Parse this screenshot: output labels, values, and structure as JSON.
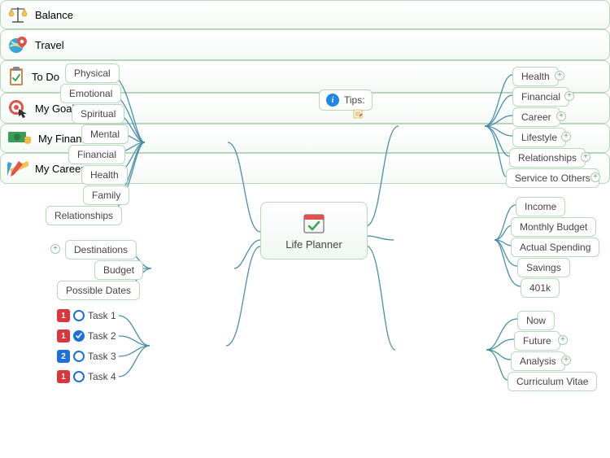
{
  "center": {
    "label": "Life Planner"
  },
  "tips": {
    "label": "Tips:"
  },
  "branches": {
    "balance": {
      "label": "Balance",
      "children": [
        "Physical",
        "Emotional",
        "Spiritual",
        "Mental",
        "Financial",
        "Health",
        "Family",
        "Relationships"
      ]
    },
    "travel": {
      "label": "Travel",
      "children": [
        "Destinations",
        "Budget",
        "Possible Dates"
      ]
    },
    "todo": {
      "label": "To Do",
      "tasks": [
        {
          "priority": "1",
          "priColor": "red",
          "done": false,
          "label": "Task 1"
        },
        {
          "priority": "1",
          "priColor": "red",
          "done": true,
          "label": "Task 2"
        },
        {
          "priority": "2",
          "priColor": "blue",
          "done": false,
          "label": "Task 3"
        },
        {
          "priority": "1",
          "priColor": "red",
          "done": false,
          "label": "Task 4"
        }
      ]
    },
    "goals": {
      "label": "My Goals",
      "children": [
        "Health",
        "Financial",
        "Career",
        "Lifestyle",
        "Relationships",
        "Service to Others"
      ]
    },
    "finances": {
      "label": "My Finances",
      "children": [
        "Income",
        "Monthly Budget",
        "Actual Spending",
        "Savings",
        "401k"
      ]
    },
    "career": {
      "label": "My Career",
      "children": [
        "Now",
        "Future",
        "Analysis",
        "Curriculum Vitae"
      ]
    }
  }
}
